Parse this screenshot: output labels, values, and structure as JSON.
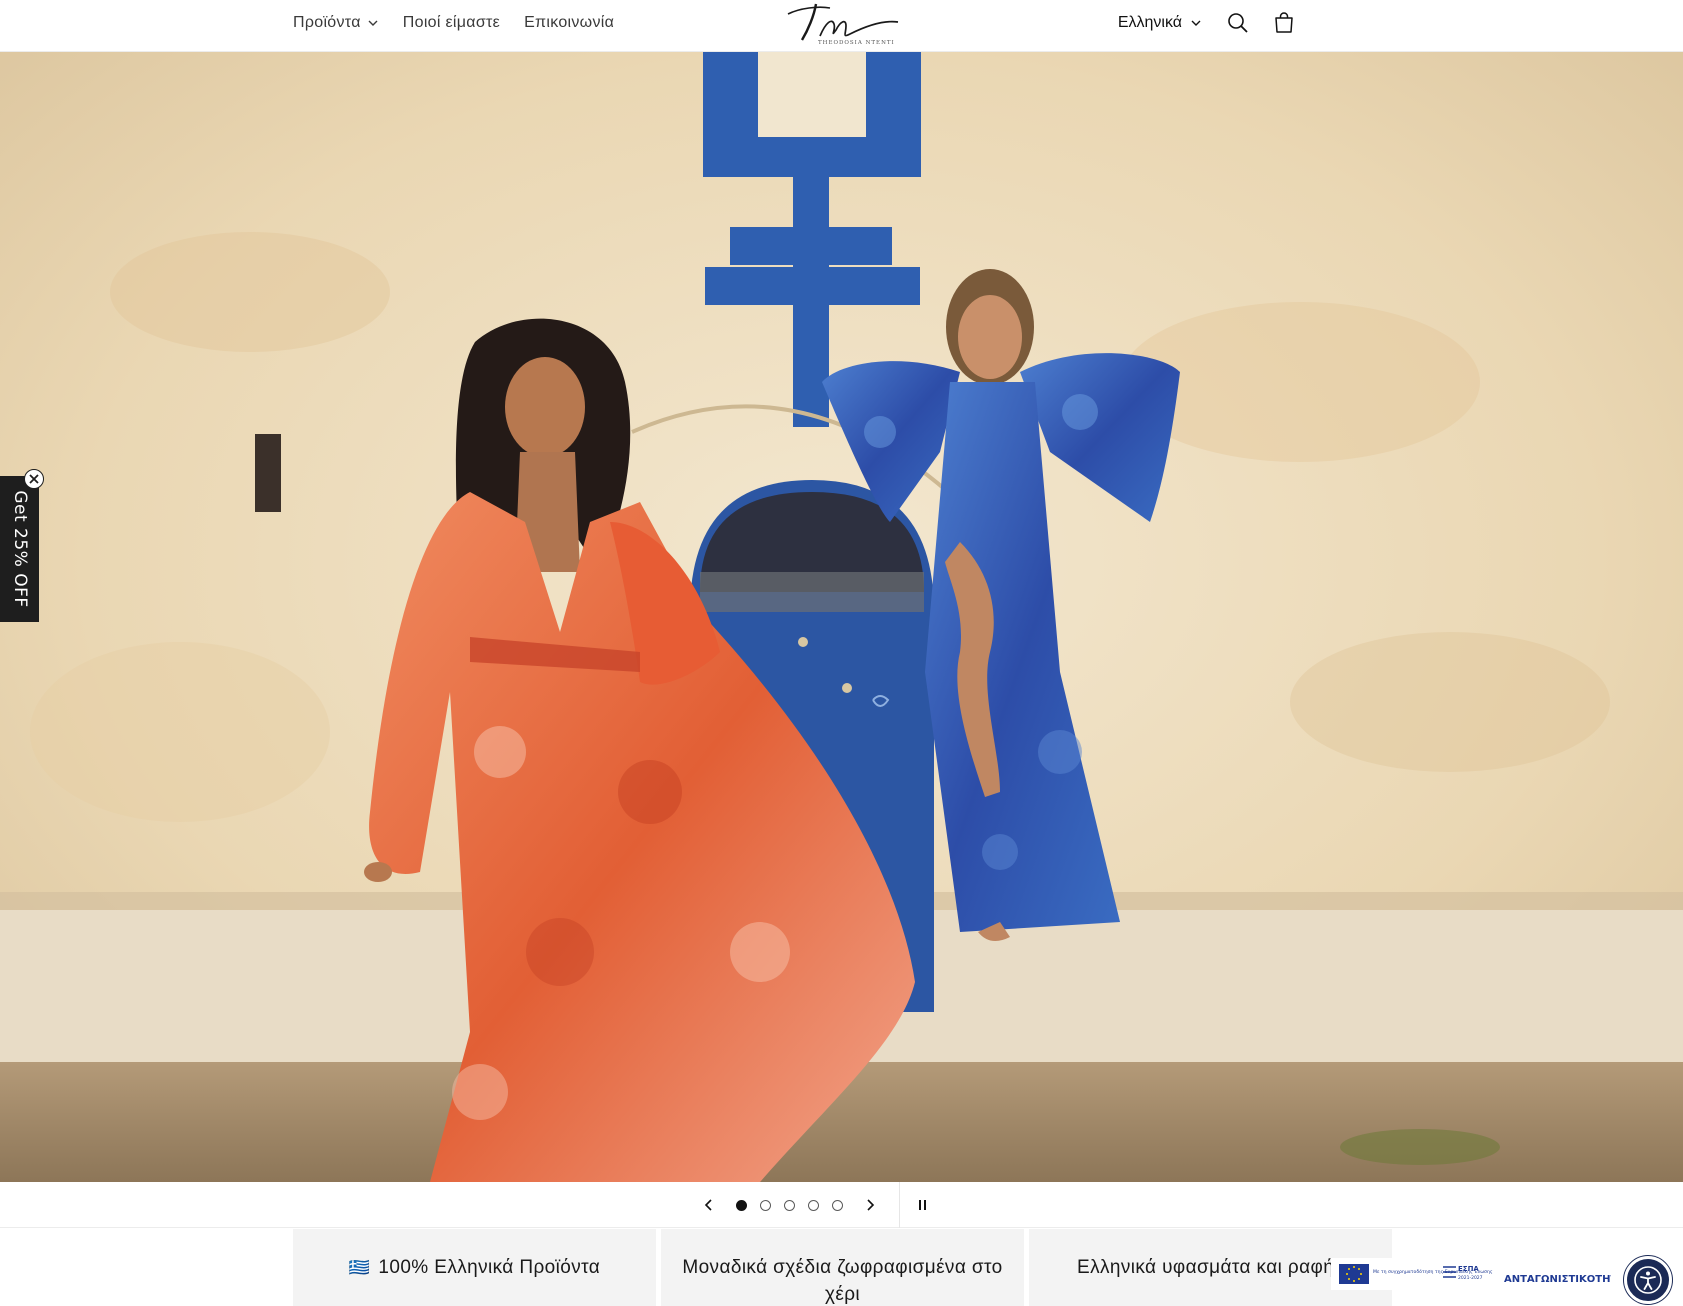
{
  "header": {
    "nav": [
      {
        "label": "Προϊόντα",
        "has_dropdown": true
      },
      {
        "label": "Ποιοί είμαστε"
      },
      {
        "label": "Επικοινωνία"
      }
    ],
    "logo_text": "THEODOSIA NTENTI",
    "language": "Ελληνικά"
  },
  "promo": {
    "label": "Get 25% OFF"
  },
  "slider": {
    "slide_count": 5,
    "active_slide": 1
  },
  "features": [
    {
      "flag": "🇬🇷",
      "text": "100% Ελληνικά Προϊόντα"
    },
    {
      "text": "Μοναδικά σχέδια ζωφραφισμένα στο χέρι"
    },
    {
      "text": "Ελληνικά υφασμάτα και ραφή"
    }
  ],
  "espa_banner": {
    "eu_text": "Με τη συγχρηματοδότηση της Ευρωπαϊκής Ένωσης",
    "espa_label": "ΕΣΠΑ",
    "espa_years": "2021-2027",
    "program_label": "ΑΝΤΑΓΩΝΙΣΤΙΚΟΤΗΤΑ"
  },
  "colors": {
    "accent_dark": "#1b2a56",
    "wall": "#ecdcbd",
    "trim_blue": "#2f5fb0",
    "dress_orange": "#e8653b",
    "dress_blue": "#2f4fa8"
  }
}
